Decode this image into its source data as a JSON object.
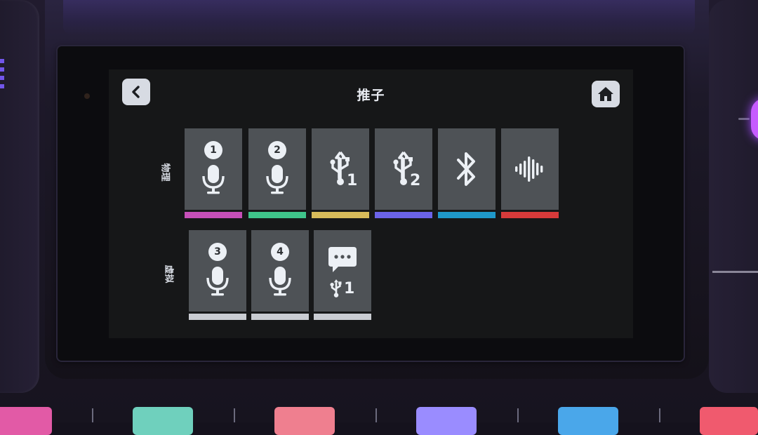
{
  "screen": {
    "title": "推子",
    "back_icon": "chevron-left-icon",
    "home_icon": "home-icon"
  },
  "rows": {
    "physical_label": "物理",
    "virtual_label": "虚拟"
  },
  "physical_channels": [
    {
      "icon": "microphone-icon",
      "badge": "1",
      "color": "#c64fb8"
    },
    {
      "icon": "microphone-icon",
      "badge": "2",
      "color": "#3fc48a"
    },
    {
      "icon": "usb-icon",
      "sub": "1",
      "color": "#d8bb5a"
    },
    {
      "icon": "usb-icon",
      "sub": "2",
      "color": "#6b63e8"
    },
    {
      "icon": "bluetooth-icon",
      "color": "#1f98c9"
    },
    {
      "icon": "sound-wave-icon",
      "color": "#d63a3a"
    }
  ],
  "virtual_channels": [
    {
      "icon": "microphone-icon",
      "badge": "3",
      "color": "#c9ccd2"
    },
    {
      "icon": "microphone-icon",
      "badge": "4",
      "color": "#c9ccd2"
    },
    {
      "icon": "chat-usb-icon",
      "sub": "1",
      "color": "#c9ccd2"
    }
  ],
  "hardware_pads": [
    "#e25aa6",
    "#6fd0bd",
    "#ef7f8f",
    "#9a8cff",
    "#4aa7ea",
    "#f05a6e"
  ]
}
